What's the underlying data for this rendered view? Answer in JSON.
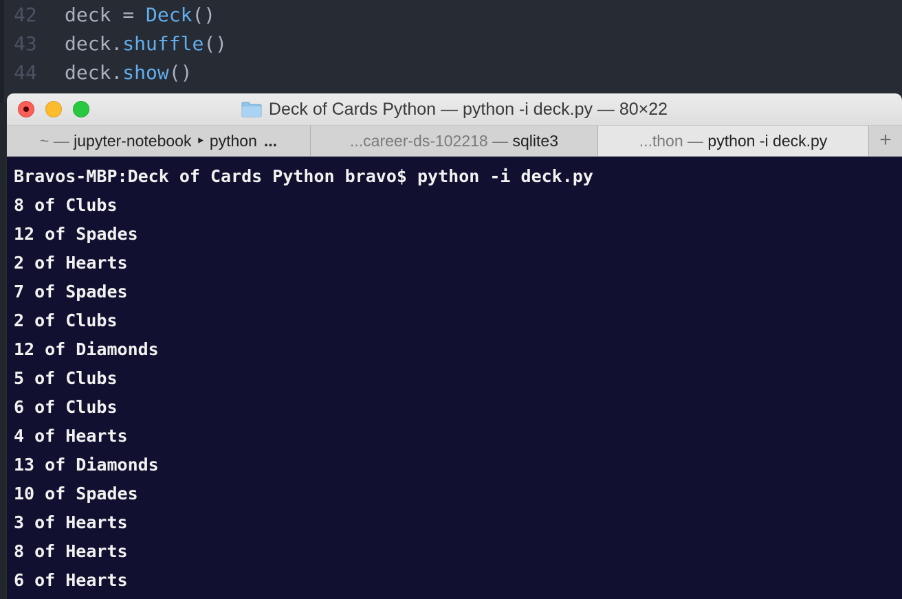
{
  "editor": {
    "lines": [
      {
        "number": "42",
        "tokens": [
          {
            "text": "deck = ",
            "kind": "plain"
          },
          {
            "text": "Deck",
            "kind": "class"
          },
          {
            "text": "()",
            "kind": "plain"
          }
        ]
      },
      {
        "number": "43",
        "tokens": [
          {
            "text": "deck.",
            "kind": "plain"
          },
          {
            "text": "shuffle",
            "kind": "method"
          },
          {
            "text": "()",
            "kind": "plain"
          }
        ]
      },
      {
        "number": "44",
        "tokens": [
          {
            "text": "deck.",
            "kind": "plain"
          },
          {
            "text": "show",
            "kind": "method"
          },
          {
            "text": "()",
            "kind": "plain"
          }
        ]
      }
    ]
  },
  "terminal": {
    "title": "Deck of Cards Python — python -i deck.py — 80×22",
    "tabs": [
      {
        "dim_prefix": "~ — ",
        "label": "jupyter-notebook ‣ python",
        "suffix": "..."
      },
      {
        "dim_prefix": "...career-ds-102218 — ",
        "label": "sqlite3",
        "suffix": ""
      },
      {
        "dim_prefix": "...thon — ",
        "label": "python -i deck.py",
        "suffix": ""
      }
    ],
    "new_tab_label": "+",
    "prompt": "Bravos-MBP:Deck of Cards Python bravo$ python -i deck.py",
    "output": [
      "8 of Clubs",
      "12 of Spades",
      "2 of Hearts",
      "7 of Spades",
      "2 of Clubs",
      "12 of Diamonds",
      "5 of Clubs",
      "6 of Clubs",
      "4 of Hearts",
      "13 of Diamonds",
      "10 of Spades",
      "3 of Hearts",
      "8 of Hearts",
      "6 of Hearts"
    ]
  },
  "colors": {
    "terminal_bg": "#111031",
    "editor_bg": "#272b33",
    "accent_blue": "#61afef"
  }
}
